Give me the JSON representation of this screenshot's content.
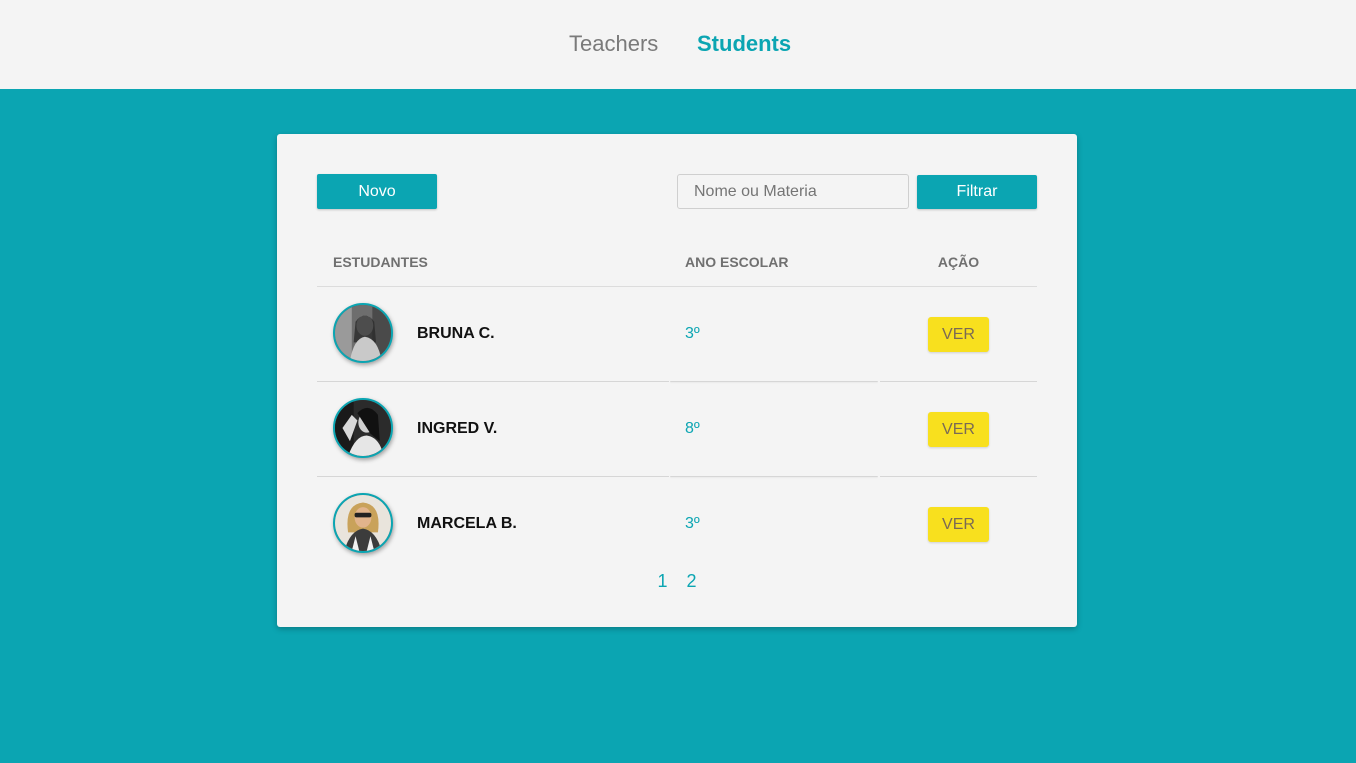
{
  "nav": {
    "teachers_label": "Teachers",
    "students_label": "Students",
    "active": "Students"
  },
  "toolbar": {
    "new_label": "Novo",
    "search_placeholder": "Nome ou Materia",
    "search_value": "",
    "filter_label": "Filtrar"
  },
  "table": {
    "headers": {
      "students": "ESTUDANTES",
      "year": "ANO ESCOLAR",
      "action": "AÇÃO"
    },
    "rows": [
      {
        "name": "BRUNA C.",
        "year": "3º",
        "action_label": "VER",
        "avatar": "student-photo"
      },
      {
        "name": "INGRED V.",
        "year": "8º",
        "action_label": "VER",
        "avatar": "student-photo"
      },
      {
        "name": "MARCELA B.",
        "year": "3º",
        "action_label": "VER",
        "avatar": "student-photo"
      }
    ]
  },
  "pagination": {
    "pages": [
      "1",
      "2"
    ]
  },
  "colors": {
    "accent": "#0ba5b2",
    "background": "#0ba5b2",
    "card": "#f4f4f4",
    "action_button": "#f8e01e"
  }
}
